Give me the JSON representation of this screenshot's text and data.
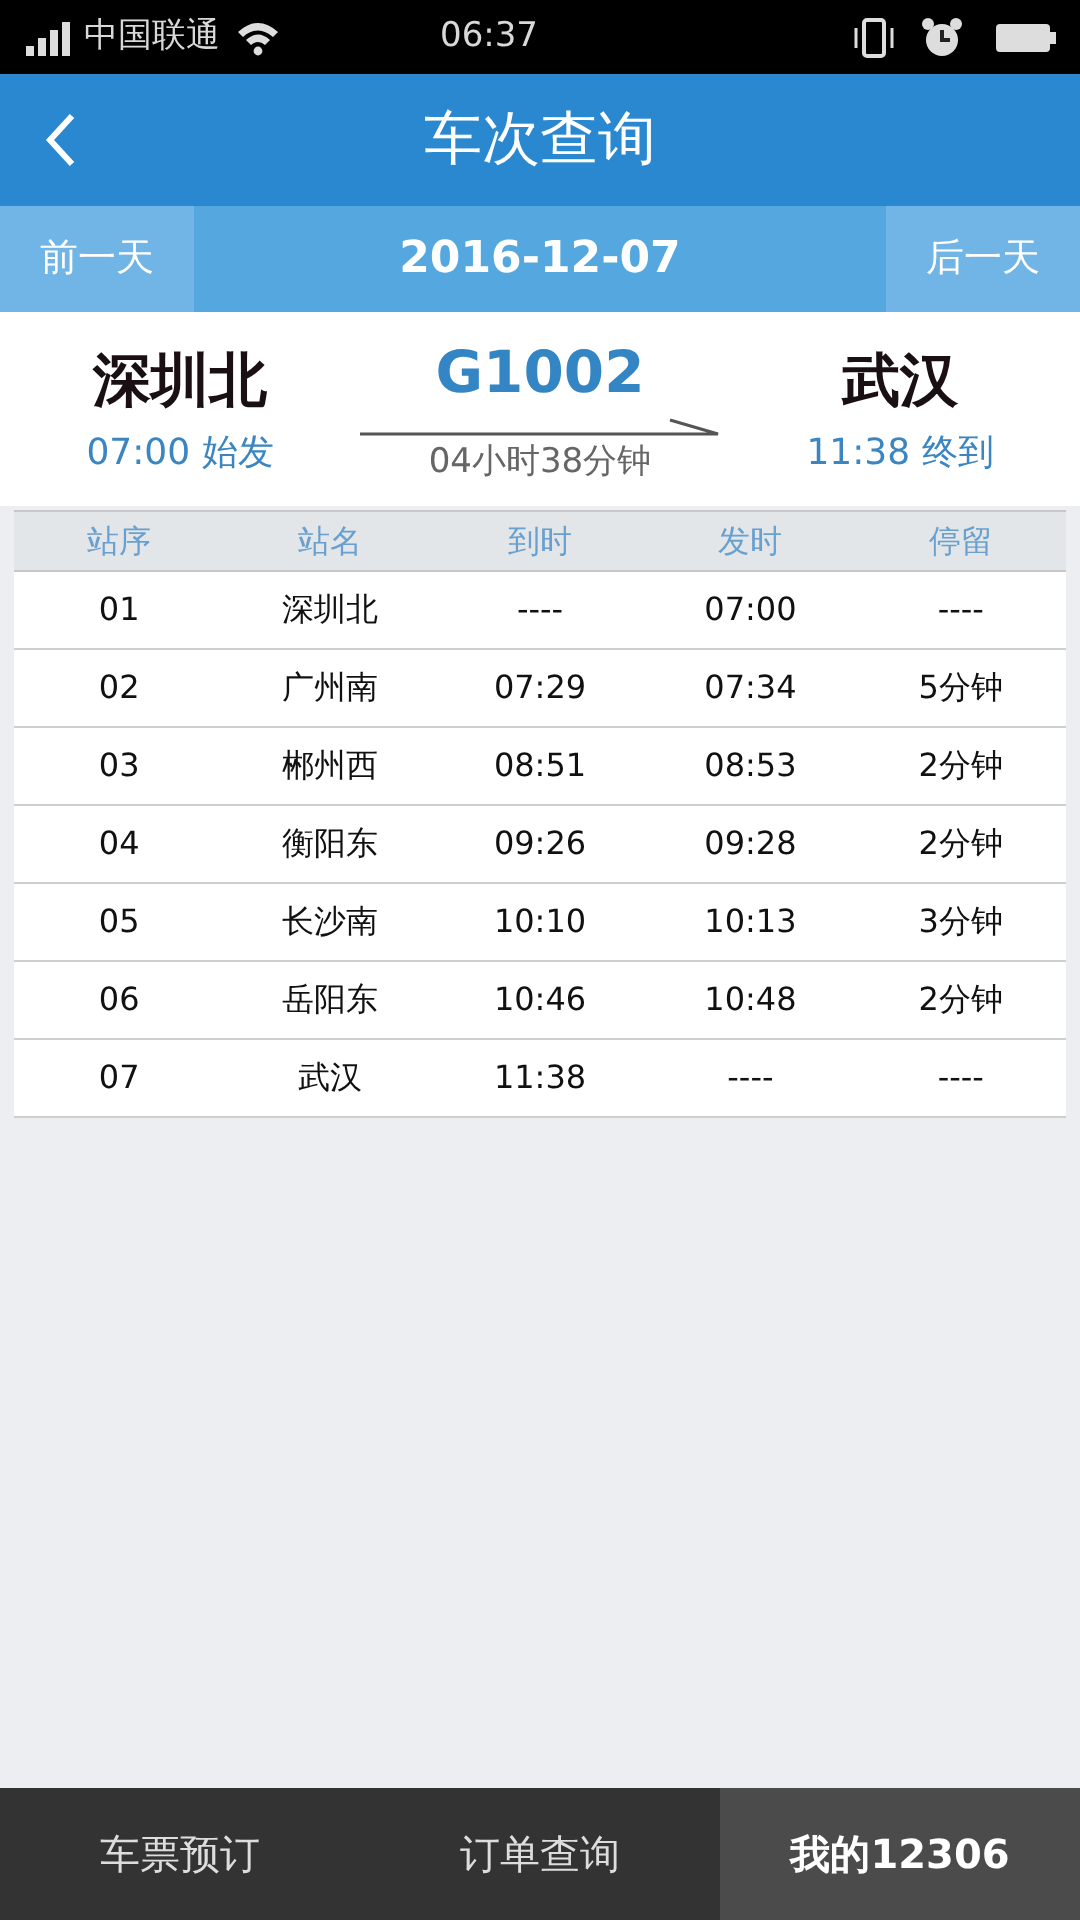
{
  "status_bar": {
    "carrier": "中国联通",
    "time": "06:37"
  },
  "header": {
    "title": "车次查询"
  },
  "date_bar": {
    "prev": "前一天",
    "date": "2016-12-07",
    "next": "后一天"
  },
  "train": {
    "from": "深圳北",
    "depart": "07:00 始发",
    "number": "G1002",
    "duration": "04小时38分钟",
    "to": "武汉",
    "arrive": "11:38 终到"
  },
  "table": {
    "columns": [
      "站序",
      "站名",
      "到时",
      "发时",
      "停留"
    ],
    "rows": [
      [
        "01",
        "深圳北",
        "----",
        "07:00",
        "----"
      ],
      [
        "02",
        "广州南",
        "07:29",
        "07:34",
        "5分钟"
      ],
      [
        "03",
        "郴州西",
        "08:51",
        "08:53",
        "2分钟"
      ],
      [
        "04",
        "衡阳东",
        "09:26",
        "09:28",
        "2分钟"
      ],
      [
        "05",
        "长沙南",
        "10:10",
        "10:13",
        "3分钟"
      ],
      [
        "06",
        "岳阳东",
        "10:46",
        "10:48",
        "2分钟"
      ],
      [
        "07",
        "武汉",
        "11:38",
        "----",
        "----"
      ]
    ]
  },
  "tabs": [
    {
      "label": "车票预订",
      "selected": false
    },
    {
      "label": "订单查询",
      "selected": false
    },
    {
      "label": "我的12306",
      "selected": true
    }
  ]
}
